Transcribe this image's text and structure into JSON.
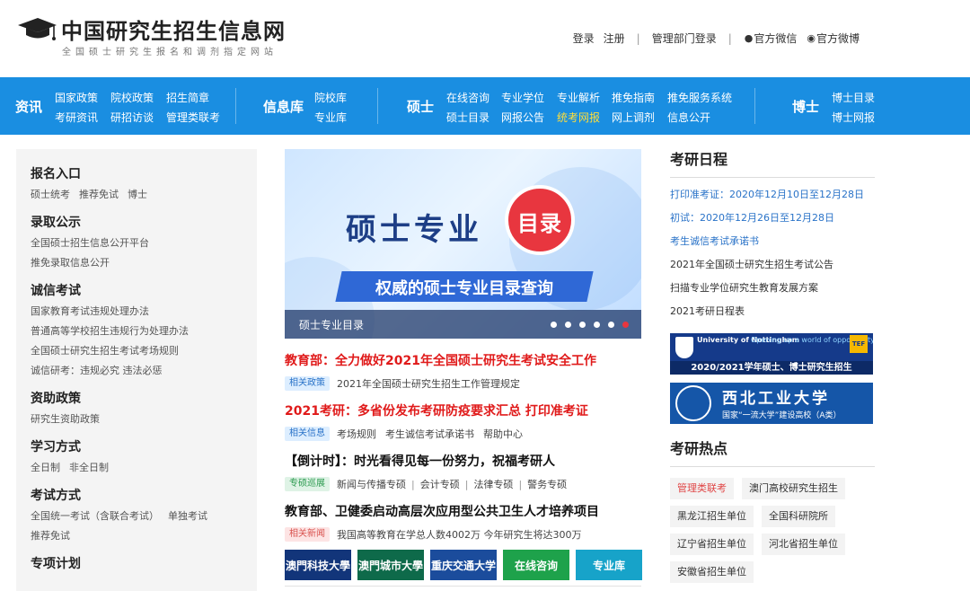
{
  "header": {
    "site_title": "中国研究生招生信息网",
    "site_subtitle": "全国硕士研究生报名和调剂指定网站",
    "login": "登录",
    "register": "注册",
    "admin_login": "管理部门登录",
    "wechat": "官方微信",
    "weibo": "官方微博"
  },
  "nav": {
    "sec1": "资讯",
    "sec1_items": [
      "国家政策",
      "院校政策",
      "招生简章",
      "考研资讯",
      "研招访谈",
      "管理类联考"
    ],
    "sec2": "信息库",
    "sec2_items": [
      "院校库",
      "专业库"
    ],
    "sec3": "硕士",
    "sec3_items": [
      "在线咨询",
      "专业学位",
      "专业解析",
      "推免指南",
      "推免服务系统",
      "硕士目录",
      "网报公告",
      "统考网报",
      "网上调剂",
      "信息公开"
    ],
    "sec4": "博士",
    "sec4_items": [
      "博士目录",
      "博士网报"
    ],
    "highlight_color": "#ffde3a",
    "bg_color": "#1a8ee1"
  },
  "sidebar": {
    "g1_title": "报名入口",
    "g1_items": [
      "硕士统考",
      "推荐免试",
      "博士"
    ],
    "g2_title": "录取公示",
    "g2_items": [
      "全国硕士招生信息公开平台",
      "推免录取信息公开"
    ],
    "g3_title": "诚信考试",
    "g3_items": [
      "国家教育考试违规处理办法",
      "普通高等学校招生违规行为处理办法",
      "全国硕士研究生招生考试考场规则",
      "诚信研考：违规必究 违法必惩"
    ],
    "g4_title": "资助政策",
    "g4_items": [
      "研究生资助政策"
    ],
    "g5_title": "学习方式",
    "g5_items": [
      "全日制",
      "非全日制"
    ],
    "g6_title": "考试方式",
    "g6_items": [
      "全国统一考试（含联合考试）",
      "单独考试",
      "推荐免试"
    ],
    "g7_title": "专项计划"
  },
  "banner": {
    "headline_part1": "硕士专业",
    "headline_badge": "目录",
    "strip": "权威的硕士专业目录查询",
    "caption": "硕士专业目录"
  },
  "news": {
    "h1": "教育部：全力做好2021年全国硕士研究生考试安全工作",
    "h1_tag": "相关政策",
    "h1_meta": [
      "2021年全国硕士研究生招生工作管理规定"
    ],
    "h2": "2021考研：多省份发布考研防疫要求汇总  打印准考证",
    "h2_tag": "相关信息",
    "h2_meta": [
      "考场规则",
      "考生诚信考试承诺书",
      "帮助中心"
    ],
    "h3": "【倒计时】：时光看得见每一份努力，祝福考研人",
    "h3_tag": "专硕巡展",
    "h3_meta": [
      "新闻与传播专硕",
      "会计专硕",
      "法律专硕",
      "警务专硕"
    ],
    "h4": "教育部、卫健委启动高层次应用型公共卫生人才培养项目",
    "h4_tag": "相关新闻",
    "h4_meta": [
      "我国高等教育在学总人数4002万 今年研究生将达300万"
    ]
  },
  "tiles": [
    {
      "label": "澳門科技大學",
      "color": "#12357a"
    },
    {
      "label": "澳門城市大學",
      "color": "#0e6a4a"
    },
    {
      "label": "重庆交通大学",
      "color": "#1b4c9c"
    },
    {
      "label": "在线咨询",
      "color": "#1ea24b"
    },
    {
      "label": "专业库",
      "color": "#17a3c9"
    }
  ],
  "schedule": {
    "title": "考研日程",
    "items": [
      "打印准考证：2020年12月10日至12月28日",
      "初试：2020年12月26日至12月28日",
      "考生诚信考试承诺书",
      "2021年全国硕士研究生招生考试公告",
      "扫描专业学位研究生教育发展方案",
      "2021考研日程表"
    ]
  },
  "ads": {
    "nott_name": "University of Nottingham",
    "nott_slogan": "Opening up a world of opportunity",
    "nott_title": "2020/2021学年硕士、博士研究生招生",
    "nwpu_name": "西北工业大学",
    "nwpu_slogan": "国家“一流大学”建设高校（A类）"
  },
  "hot": {
    "title": "考研热点",
    "chips": [
      "管理类联考",
      "澳门高校研究生招生",
      "黑龙江招生单位",
      "全国科研院所",
      "辽宁省招生单位",
      "河北省招生单位",
      "安徽省招生单位"
    ]
  }
}
